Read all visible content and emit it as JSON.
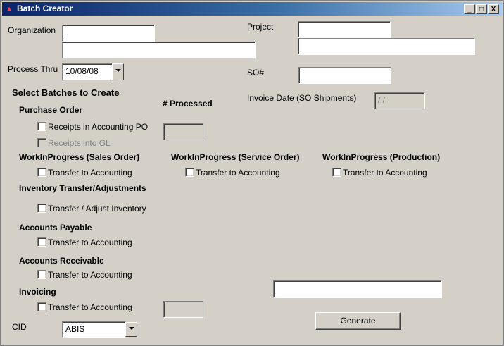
{
  "window": {
    "title": "Batch Creator",
    "minimize": "_",
    "maximize": "□",
    "close": "X"
  },
  "labels": {
    "organization": "Organization",
    "project": "Project",
    "process_thru": "Process Thru",
    "so_number": "SO#",
    "select_batches": "Select Batches to Create",
    "processed": "# Processed",
    "invoice_date": "Invoice Date (SO Shipments)",
    "purchase_order": "Purchase Order",
    "wip_sales": "WorkInProgress (Sales Order)",
    "wip_service": "WorkInProgress (Service Order)",
    "wip_production": "WorkInProgress (Production)",
    "inventory_transfer": "Inventory Transfer/Adjustments",
    "accounts_payable": "Accounts Payable",
    "accounts_receivable": "Accounts Receivable",
    "invoicing": "Invoicing",
    "cid": "CID"
  },
  "fields": {
    "organization_code": "",
    "organization_name": "",
    "project_code": "",
    "project_name": "",
    "process_thru": "10/08/08",
    "so_number": "",
    "invoice_date": "/ /",
    "processed_po": "",
    "processed_invoicing": "",
    "status": "",
    "cid": "ABIS"
  },
  "checkboxes": {
    "receipts_accounting_po": "Receipts in Accounting PO",
    "receipts_gl": "Receipts into GL",
    "wip_sales_transfer": "Transfer to Accounting",
    "wip_service_transfer": "Transfer to Accounting",
    "wip_production_transfer": "Transfer to Accounting",
    "inventory_adjust": "Transfer / Adjust Inventory",
    "ap_transfer": "Transfer to Accounting",
    "ar_transfer": "Transfer to Accounting",
    "invoicing_transfer": "Transfer to Accounting"
  },
  "buttons": {
    "generate": "Generate"
  }
}
